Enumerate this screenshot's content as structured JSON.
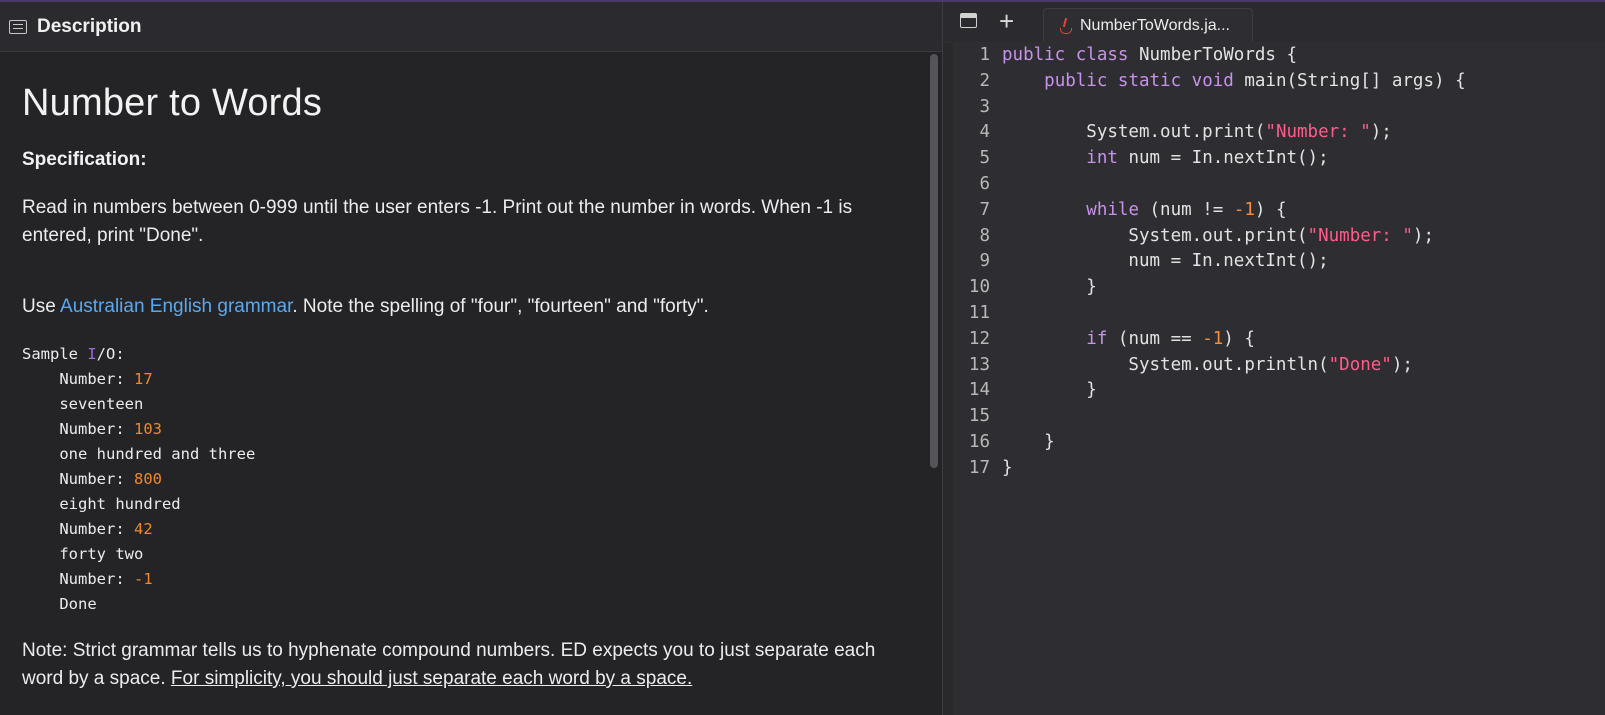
{
  "left_header": {
    "title": "Description"
  },
  "problem": {
    "title": "Number to Words",
    "spec_heading": "Specification:",
    "spec_text": "Read in numbers between 0-999 until the user enters -1. Print out the number in words. When -1 is entered, print \"Done\".",
    "grammar_prefix": "Use ",
    "grammar_link": "Australian English grammar",
    "grammar_suffix": ". Note the spelling of \"four\", \"fourteen\" and \"forty\".",
    "sample_title_a": "Sample ",
    "sample_title_i": "I",
    "sample_title_b": "/O:",
    "sample_io": [
      {
        "kind": "prompt",
        "label": "    Number: ",
        "value": "17"
      },
      {
        "kind": "output",
        "text": "    seventeen"
      },
      {
        "kind": "prompt",
        "label": "    Number: ",
        "value": "103"
      },
      {
        "kind": "output",
        "text": "    one hundred and three"
      },
      {
        "kind": "prompt",
        "label": "    Number: ",
        "value": "800"
      },
      {
        "kind": "output",
        "text": "    eight hundred"
      },
      {
        "kind": "prompt",
        "label": "    Number: ",
        "value": "42"
      },
      {
        "kind": "output",
        "text": "    forty two"
      },
      {
        "kind": "prompt",
        "label": "    Number: ",
        "value": "-1"
      },
      {
        "kind": "output",
        "text": "    Done"
      }
    ],
    "note_text": "Note: Strict grammar tells us to hyphenate compound numbers. ED expects you to just separate each word by a space. ",
    "note_underlined": "For simplicity, you should just separate each word by a space."
  },
  "editor": {
    "tab_name": "NumberToWords.ja...",
    "lines": [
      [
        [
          "kw",
          "public class"
        ],
        [
          "t",
          " NumberToWords {"
        ]
      ],
      [
        [
          "t",
          "    "
        ],
        [
          "kw",
          "public static void"
        ],
        [
          "t",
          " main(String[] args) {"
        ]
      ],
      [],
      [
        [
          "t",
          "        System.out.print("
        ],
        [
          "str",
          "\"Number: \""
        ],
        [
          "t",
          ");"
        ]
      ],
      [
        [
          "t",
          "        "
        ],
        [
          "kw",
          "int"
        ],
        [
          "t",
          " num = In.nextInt();"
        ]
      ],
      [],
      [
        [
          "t",
          "        "
        ],
        [
          "kw",
          "while"
        ],
        [
          "t",
          " (num != "
        ],
        [
          "num",
          "-1"
        ],
        [
          "t",
          ") {"
        ]
      ],
      [
        [
          "t",
          "            System.out.print("
        ],
        [
          "str",
          "\"Number: \""
        ],
        [
          "t",
          ");"
        ]
      ],
      [
        [
          "t",
          "            num = In.nextInt();"
        ]
      ],
      [
        [
          "t",
          "        }"
        ]
      ],
      [],
      [
        [
          "t",
          "        "
        ],
        [
          "kw",
          "if"
        ],
        [
          "t",
          " (num == "
        ],
        [
          "num",
          "-1"
        ],
        [
          "t",
          ") {"
        ]
      ],
      [
        [
          "t",
          "            System.out.println("
        ],
        [
          "str",
          "\"Done\""
        ],
        [
          "t",
          ");"
        ]
      ],
      [
        [
          "t",
          "        }"
        ]
      ],
      [],
      [
        [
          "t",
          "    }"
        ]
      ],
      [
        [
          "t",
          "}"
        ]
      ]
    ]
  },
  "colors": {
    "link": "#5aa9f0",
    "keyword": "#c792ea",
    "string": "#ff5c8a",
    "number": "#f78c3a",
    "io_number": "#f0882a"
  },
  "icons": {
    "description": "description-icon",
    "panel": "panel-icon",
    "add": "plus-icon",
    "java": "java-file-icon"
  }
}
